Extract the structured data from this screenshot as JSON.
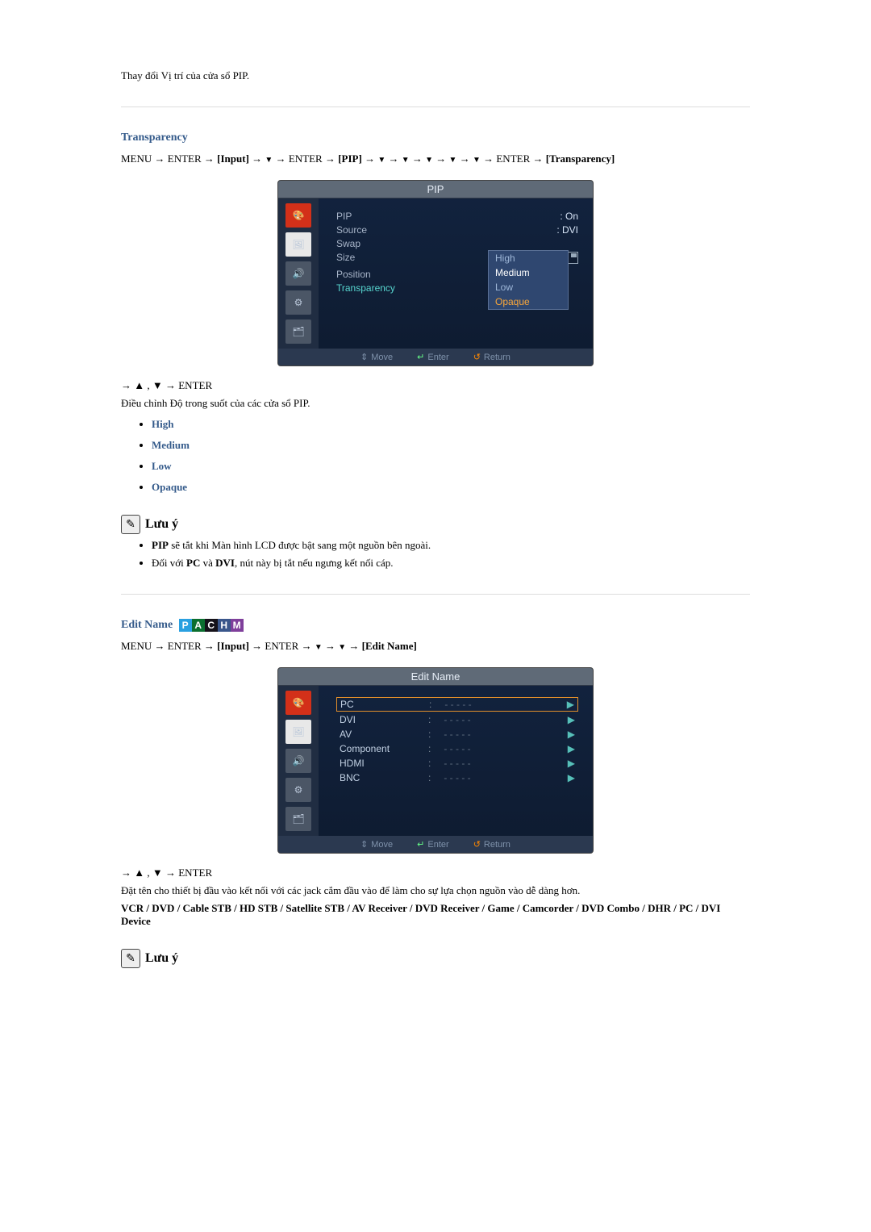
{
  "intro_text": "Thay đổi Vị trí của cửa sổ PIP.",
  "section_transparency": {
    "title": "Transparency",
    "nav_menu": "MENU",
    "nav_enter": "ENTER",
    "nav_input": "[Input]",
    "nav_pip": "[PIP]",
    "nav_transparency": "[Transparency]",
    "osd_title": "PIP",
    "rows": {
      "pip_label": "PIP",
      "pip_value": "On",
      "source_label": "Source",
      "source_value": "DVI",
      "swap_label": "Swap",
      "size_label": "Size",
      "position_label": "Position",
      "transparency_label": "Transparency"
    },
    "dropdown": {
      "high": "High",
      "medium": "Medium",
      "low": "Low",
      "opaque": "Opaque"
    },
    "footer": {
      "move": "Move",
      "enter": "Enter",
      "return": "Return"
    },
    "post_nav": "→ ▲ , ▼ → ENTER",
    "desc": "Điều chỉnh Độ trong suốt của các cửa sổ PIP.",
    "opts": {
      "high": "High",
      "medium": "Medium",
      "low": "Low",
      "opaque": "Opaque"
    },
    "note_title": "Lưu ý",
    "note1_pre": "PIP",
    "note1_post": " sẽ tắt khi Màn hình LCD được bật sang một nguồn bên ngoài.",
    "note2_pre": "Đối với ",
    "note2_pc": "PC",
    "note2_and": " và ",
    "note2_dvi": "DVI",
    "note2_post": ", nút này bị tắt nếu ngưng kết nối cáp."
  },
  "section_editname": {
    "title": "Edit Name",
    "nav_menu": "MENU",
    "nav_enter": "ENTER",
    "nav_input": "[Input]",
    "nav_edit": "[Edit Name]",
    "osd_title": "Edit Name",
    "rows": {
      "pc": "PC",
      "dvi": "DVI",
      "av": "AV",
      "component": "Component",
      "hdmi": "HDMI",
      "bnc": "BNC",
      "dash": "- - - - -"
    },
    "footer": {
      "move": "Move",
      "enter": "Enter",
      "return": "Return"
    },
    "post_nav": "→ ▲ , ▼ → ENTER",
    "desc": "Đặt tên cho thiết bị đầu vào kết nối với các jack cắm đầu vào để làm cho sự lựa chọn nguồn vào dễ dàng hơn.",
    "device_list": "VCR / DVD / Cable STB / HD STB / Satellite STB / AV Receiver / DVD Receiver / Game / Camcorder / DVD Combo / DHR / PC / DVI Device",
    "note_title": "Lưu ý"
  }
}
